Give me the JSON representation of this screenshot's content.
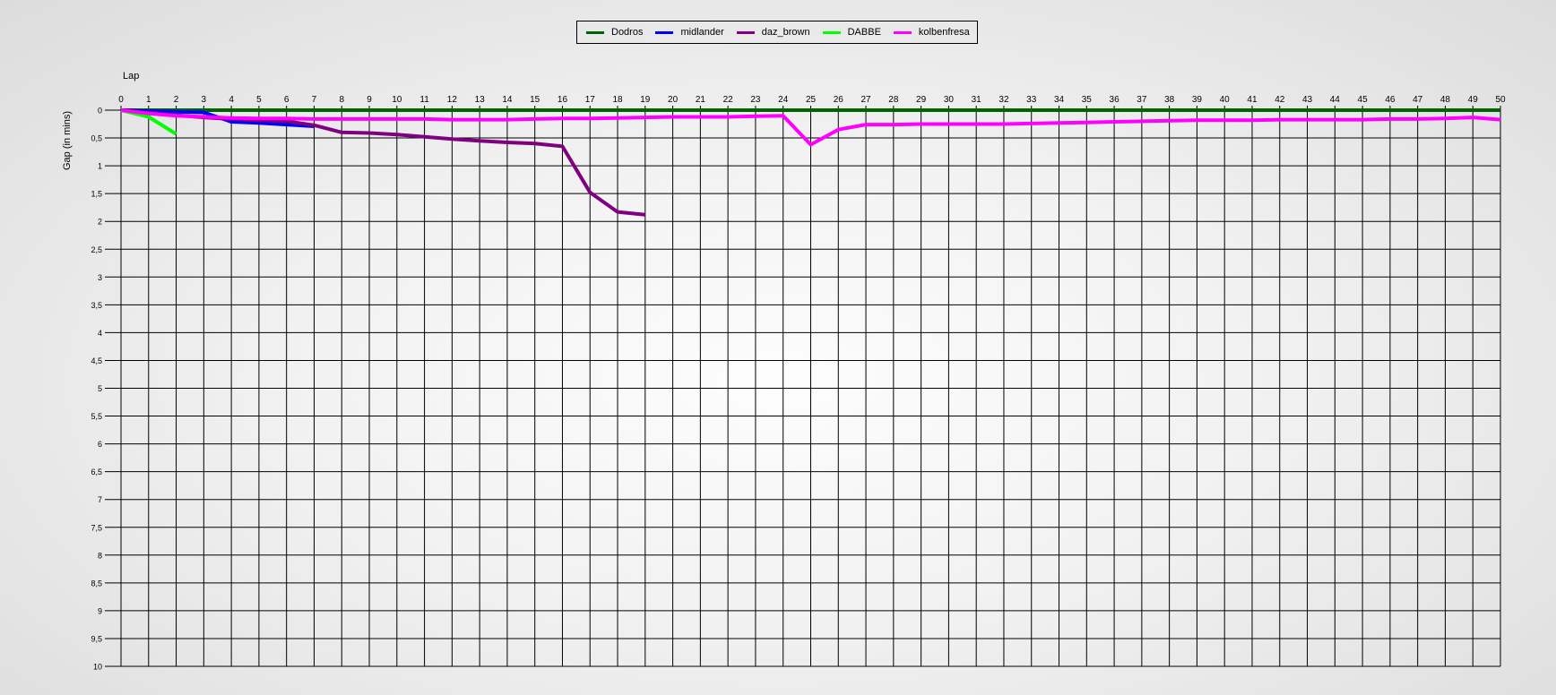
{
  "chart_data": {
    "type": "line",
    "xlabel": "Lap",
    "ylabel": "Gap (in mins)",
    "xlim": [
      0,
      50
    ],
    "ylim": [
      0,
      10
    ],
    "y_inverted": true,
    "grid": true,
    "legend_position": "top-center",
    "x_ticks": [
      "0",
      "1",
      "2",
      "3",
      "4",
      "5",
      "6",
      "7",
      "8",
      "9",
      "10",
      "11",
      "12",
      "13",
      "14",
      "15",
      "16",
      "17",
      "18",
      "19",
      "20",
      "21",
      "22",
      "23",
      "24",
      "25",
      "26",
      "27",
      "28",
      "29",
      "30",
      "31",
      "32",
      "33",
      "34",
      "35",
      "36",
      "37",
      "38",
      "39",
      "40",
      "41",
      "42",
      "43",
      "44",
      "45",
      "46",
      "47",
      "48",
      "49",
      "50"
    ],
    "y_ticks": [
      "0",
      "0,5",
      "1",
      "1,5",
      "2",
      "2,5",
      "3",
      "3,5",
      "4",
      "4,5",
      "5",
      "5,5",
      "6",
      "6,5",
      "7",
      "7,5",
      "8",
      "8,5",
      "9",
      "9,5",
      "10"
    ],
    "series": [
      {
        "name": "Dodros",
        "color": "#006400",
        "x": [
          0,
          1,
          2,
          3,
          4,
          5,
          6,
          7,
          8,
          9,
          10,
          11,
          12,
          13,
          14,
          15,
          16,
          17,
          18,
          19,
          20,
          21,
          22,
          23,
          24,
          25,
          26,
          27,
          28,
          29,
          30,
          31,
          32,
          33,
          34,
          35,
          36,
          37,
          38,
          39,
          40,
          41,
          42,
          43,
          44,
          45,
          46,
          47,
          48,
          49,
          50
        ],
        "values": [
          0,
          0,
          0,
          0,
          0,
          0,
          0,
          0,
          0,
          0,
          0,
          0,
          0,
          0,
          0,
          0,
          0,
          0,
          0,
          0,
          0,
          0,
          0,
          0,
          0,
          0,
          0,
          0,
          0,
          0,
          0,
          0,
          0,
          0,
          0,
          0,
          0,
          0,
          0,
          0,
          0,
          0,
          0,
          0,
          0,
          0,
          0,
          0,
          0,
          0,
          0
        ]
      },
      {
        "name": "midlander",
        "color": "#0000ff",
        "x": [
          0,
          1,
          2,
          3,
          4,
          5,
          6,
          7
        ],
        "values": [
          0,
          0.02,
          0.03,
          0.04,
          0.21,
          0.23,
          0.26,
          0.29
        ]
      },
      {
        "name": "daz_brown",
        "color": "#800080",
        "x": [
          0,
          1,
          2,
          3,
          4,
          5,
          6,
          7,
          8,
          9,
          10,
          11,
          12,
          13,
          14,
          15,
          16,
          17,
          18,
          19
        ],
        "values": [
          0,
          0.05,
          0.09,
          0.13,
          0.16,
          0.18,
          0.2,
          0.27,
          0.4,
          0.41,
          0.44,
          0.48,
          0.52,
          0.55,
          0.58,
          0.6,
          0.65,
          1.48,
          1.83,
          1.88
        ]
      },
      {
        "name": "DABBE",
        "color": "#00ff00",
        "x": [
          0,
          1,
          2
        ],
        "values": [
          0,
          0.12,
          0.43
        ]
      },
      {
        "name": "kolbenfresa",
        "color": "#ff00ff",
        "x": [
          0,
          1,
          2,
          3,
          4,
          5,
          6,
          7,
          8,
          9,
          10,
          11,
          12,
          13,
          14,
          15,
          16,
          17,
          18,
          19,
          20,
          21,
          22,
          23,
          24,
          25,
          26,
          27,
          28,
          29,
          30,
          31,
          32,
          33,
          34,
          35,
          36,
          37,
          38,
          39,
          40,
          41,
          42,
          43,
          44,
          45,
          46,
          47,
          48,
          49,
          50
        ],
        "values": [
          0,
          0.06,
          0.1,
          0.12,
          0.14,
          0.15,
          0.15,
          0.16,
          0.16,
          0.16,
          0.16,
          0.16,
          0.17,
          0.17,
          0.17,
          0.16,
          0.15,
          0.15,
          0.14,
          0.13,
          0.12,
          0.12,
          0.12,
          0.11,
          0.1,
          0.62,
          0.35,
          0.26,
          0.26,
          0.25,
          0.25,
          0.25,
          0.25,
          0.24,
          0.23,
          0.22,
          0.21,
          0.2,
          0.19,
          0.18,
          0.18,
          0.18,
          0.17,
          0.17,
          0.17,
          0.17,
          0.16,
          0.16,
          0.15,
          0.13,
          0.17
        ]
      }
    ]
  }
}
